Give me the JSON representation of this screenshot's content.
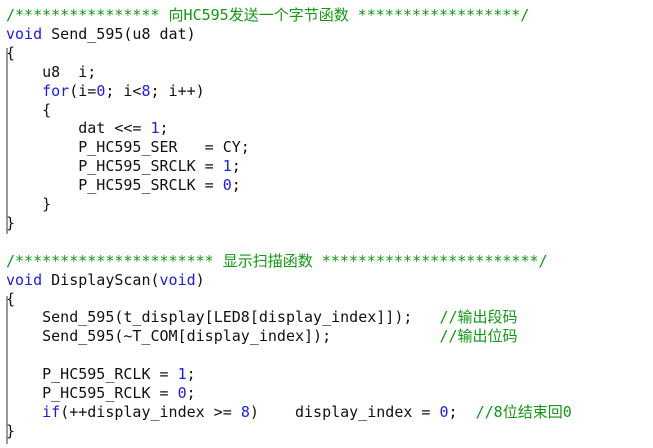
{
  "editor": {
    "lines": [
      [
        {
          "t": "/**************** 向HC595发送一个字节函数 ******************/",
          "c": "cm"
        }
      ],
      [
        {
          "t": "void",
          "c": "kw"
        },
        {
          "t": " Send_595(u8 dat)",
          "c": "tx"
        }
      ],
      [
        {
          "t": "{",
          "c": "tx"
        }
      ],
      [
        {
          "t": "    u8  i;",
          "c": "tx"
        }
      ],
      [
        {
          "t": "    ",
          "c": "tx"
        },
        {
          "t": "for",
          "c": "kw"
        },
        {
          "t": "(i=",
          "c": "tx"
        },
        {
          "t": "0",
          "c": "num"
        },
        {
          "t": "; i<",
          "c": "tx"
        },
        {
          "t": "8",
          "c": "num"
        },
        {
          "t": "; i++)",
          "c": "tx"
        }
      ],
      [
        {
          "t": "    {",
          "c": "tx"
        }
      ],
      [
        {
          "t": "        dat <<= ",
          "c": "tx"
        },
        {
          "t": "1",
          "c": "num"
        },
        {
          "t": ";",
          "c": "tx"
        }
      ],
      [
        {
          "t": "        P_HC595_SER   = CY;",
          "c": "tx"
        }
      ],
      [
        {
          "t": "        P_HC595_SRCLK = ",
          "c": "tx"
        },
        {
          "t": "1",
          "c": "num"
        },
        {
          "t": ";",
          "c": "tx"
        }
      ],
      [
        {
          "t": "        P_HC595_SRCLK = ",
          "c": "tx"
        },
        {
          "t": "0",
          "c": "num"
        },
        {
          "t": ";",
          "c": "tx"
        }
      ],
      [
        {
          "t": "    }",
          "c": "tx"
        }
      ],
      [
        {
          "t": "}",
          "c": "tx"
        }
      ],
      [
        {
          "t": "",
          "c": "tx"
        }
      ],
      [
        {
          "t": "/********************** 显示扫描函数 ************************/",
          "c": "cm"
        }
      ],
      [
        {
          "t": "void",
          "c": "kw"
        },
        {
          "t": " DisplayScan(",
          "c": "tx"
        },
        {
          "t": "void",
          "c": "kw"
        },
        {
          "t": ")",
          "c": "tx"
        }
      ],
      [
        {
          "t": "{",
          "c": "tx"
        }
      ],
      [
        {
          "t": "    Send_595(t_display[LED8[display_index]]);   ",
          "c": "tx"
        },
        {
          "t": "//输出段码",
          "c": "cm"
        }
      ],
      [
        {
          "t": "    Send_595(~T_COM[display_index]);            ",
          "c": "tx"
        },
        {
          "t": "//输出位码",
          "c": "cm"
        }
      ],
      [
        {
          "t": "",
          "c": "tx"
        }
      ],
      [
        {
          "t": "    P_HC595_RCLK = ",
          "c": "tx"
        },
        {
          "t": "1",
          "c": "num"
        },
        {
          "t": ";",
          "c": "tx"
        }
      ],
      [
        {
          "t": "    P_HC595_RCLK = ",
          "c": "tx"
        },
        {
          "t": "0",
          "c": "num"
        },
        {
          "t": ";",
          "c": "tx"
        }
      ],
      [
        {
          "t": "    ",
          "c": "tx"
        },
        {
          "t": "if",
          "c": "kw"
        },
        {
          "t": "(++display_index >= ",
          "c": "tx"
        },
        {
          "t": "8",
          "c": "num"
        },
        {
          "t": ")    display_index = ",
          "c": "tx"
        },
        {
          "t": "0",
          "c": "num"
        },
        {
          "t": ";  ",
          "c": "tx"
        },
        {
          "t": "//8位结束回0",
          "c": "cm"
        }
      ],
      [
        {
          "t": "}",
          "c": "tx"
        }
      ]
    ]
  }
}
